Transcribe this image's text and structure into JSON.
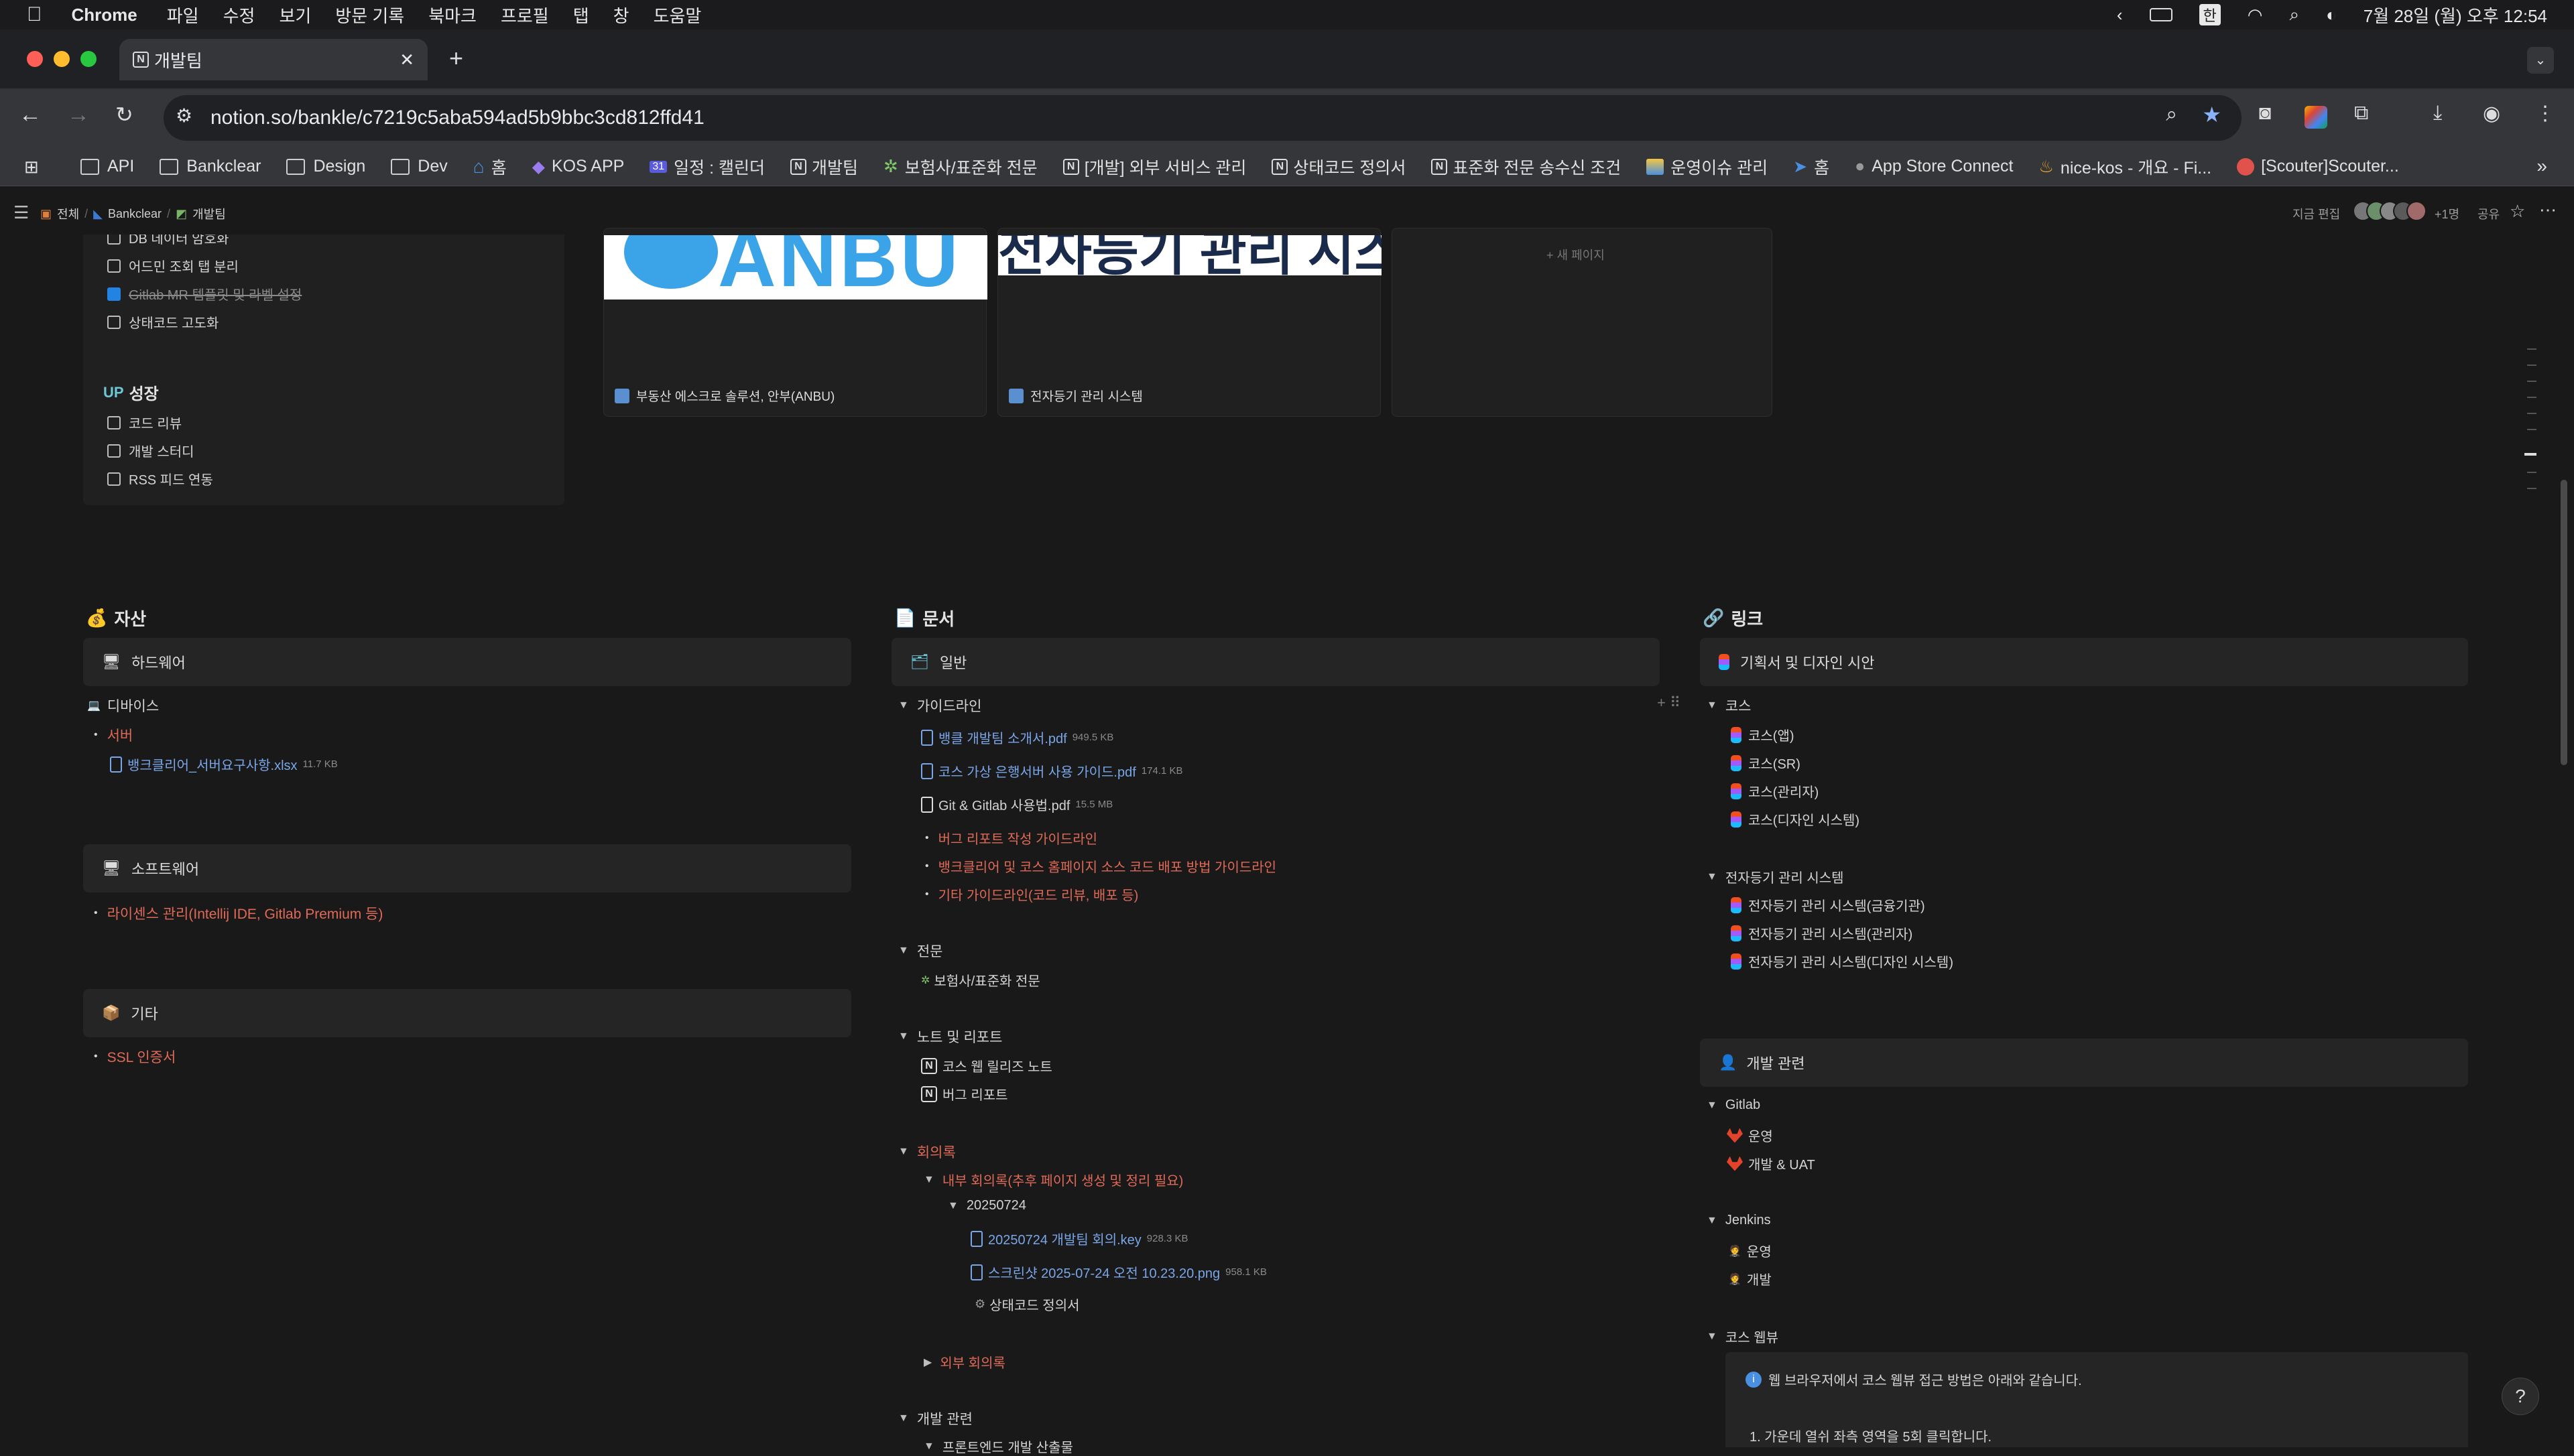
{
  "menubar": {
    "app": "Chrome",
    "items": [
      "파일",
      "수정",
      "보기",
      "방문 기록",
      "북마크",
      "프로필",
      "탭",
      "창",
      "도움말"
    ],
    "clock": "7월 28일 (월) 오후 12:54",
    "input_source": "한"
  },
  "browser": {
    "tab_title": "개발팀",
    "url": "notion.so/bankle/c7219c5aba594ad5b9bbc3cd812ffd41",
    "bookmarks": [
      "API",
      "Bankclear",
      "Design",
      "Dev",
      "홈",
      "KOS APP",
      "일정 : 캘린더",
      "개발팀",
      "보험사/표준화 전문",
      "[개발] 외부 서비스 관리",
      "상태코드 정의서",
      "표준화 전문 송수신 조건",
      "운영이슈 관리",
      "홈",
      "App Store Connect",
      "nice-kos - 개요 - Fi...",
      "[Scouter]Scouter..."
    ]
  },
  "notion_top": {
    "breadcrumb": [
      "전체",
      "Bankclear",
      "개발팀"
    ],
    "edited": "지금 편집",
    "viewers": "+1명",
    "share": "공유"
  },
  "todo": {
    "items": [
      {
        "label": "DB 데이터 암호화",
        "checked": false
      },
      {
        "label": "어드민 조회 탭 분리",
        "checked": false
      },
      {
        "label": "Gitlab MR 템플릿 및 라벨 설정",
        "checked": true
      },
      {
        "label": "상태코드 고도화",
        "checked": false
      }
    ],
    "growth_title": "성장",
    "growth_items": [
      "코드 리뷰",
      "개발 스터디",
      "RSS 피드 연동"
    ]
  },
  "gallery": {
    "cards": [
      {
        "banner": "ANBU",
        "title": "부동산 에스크로 솔루션, 안부(ANBU)"
      },
      {
        "banner": "전자등기 관리 시스템",
        "title": "전자등기 관리 시스템"
      }
    ],
    "new_page": "+ 새 페이지"
  },
  "assets": {
    "title": "자산",
    "hardware": "하드웨어",
    "device": "디바이스",
    "server": "서버",
    "server_file": "뱅크클리어_서버요구사항.xlsx",
    "server_file_size": "11.7 KB",
    "software": "소프트웨어",
    "license": "라이센스 관리(Intellij IDE, Gitlab Premium 등)",
    "etc": "기타",
    "ssl": "SSL 인증서"
  },
  "docs": {
    "title": "문서",
    "general": "일반",
    "guideline": "가이드라인",
    "files": [
      {
        "name": "뱅클 개발팀 소개서.pdf",
        "size": "949.5 KB"
      },
      {
        "name": "코스 가상 은행서버 사용 가이드.pdf",
        "size": "174.1 KB"
      },
      {
        "name": "Git & Gitlab 사용법.pdf",
        "size": "15.5 MB"
      }
    ],
    "guides": [
      "버그 리포트 작성 가이드라인",
      "뱅크클리어 및 코스 홈페이지 소스 코드 배포 방법 가이드라인",
      "기타 가이드라인(코드 리뷰, 배포 등)"
    ],
    "specs": "전문",
    "specs_item": "보험사/표준화 전문",
    "notes": "노트 및 리포트",
    "notes_items": [
      "코스 웹 릴리즈 노트",
      "버그 리포트"
    ],
    "minutes": "회의록",
    "internal": "내부 회의록(추후 페이지 생성 및 정리 필요)",
    "date": "20250724",
    "minute_files": [
      {
        "name": "20250724 개발팀 회의.key",
        "size": "928.3 KB"
      },
      {
        "name": "스크린샷 2025-07-24 오전 10.23.20.png",
        "size": "958.1 KB"
      }
    ],
    "status_doc": "상태코드 정의서",
    "external": "외부 회의록",
    "dev": "개발 관련",
    "dev_sub": "프론트엔드 개발 산출물"
  },
  "links": {
    "title": "링크",
    "plan": "기획서 및 디자인 시안",
    "kos": "코스",
    "kos_items": [
      "코스(앱)",
      "코스(SR)",
      "코스(관리자)",
      "코스(디자인 시스템)"
    ],
    "reg": "전자등기 관리 시스템",
    "reg_items": [
      "전자등기 관리 시스템(금융기관)",
      "전자등기 관리 시스템(관리자)",
      "전자등기 관리 시스템(디자인 시스템)"
    ],
    "devrel": "개발 관련",
    "gitlab": "Gitlab",
    "gitlab_items": [
      "운영",
      "개발 & UAT"
    ],
    "jenkins": "Jenkins",
    "jenkins_items": [
      "운영",
      "개발"
    ],
    "kosweb": "코스 웹뷰",
    "callout": "웹 브라우저에서 코스 웹뷰 접근 방법은 아래와 같습니다.",
    "step1": "1.  가운데 열쉬 좌측 영역을 5회 클릭합니다."
  }
}
